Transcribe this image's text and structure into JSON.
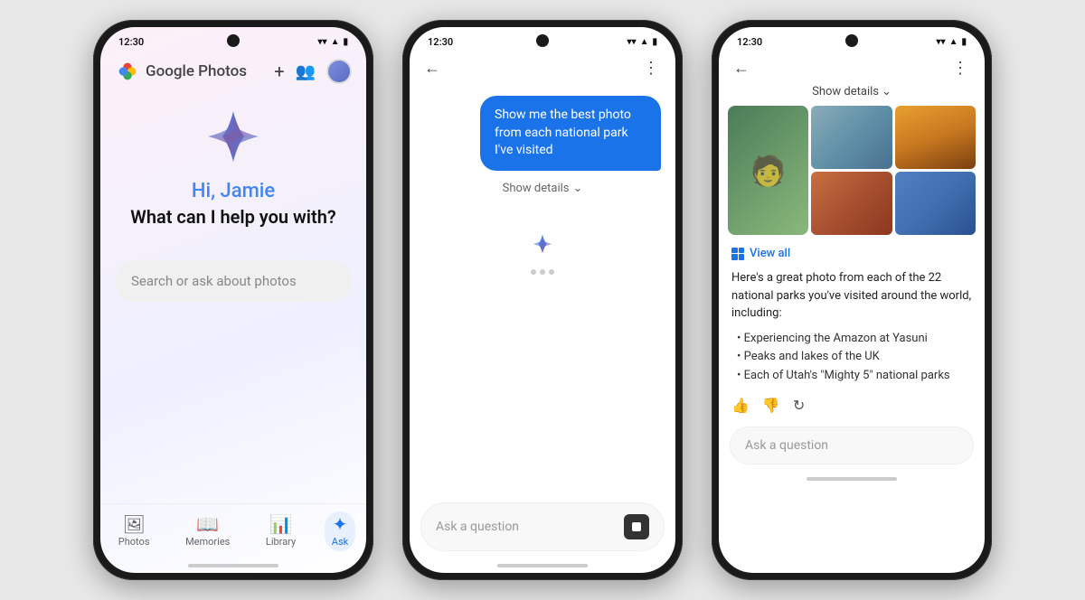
{
  "phone1": {
    "status_time": "12:30",
    "logo_text": "Google Photos",
    "greeting": "Hi, Jamie",
    "subtext": "What can I help you with?",
    "search_placeholder": "Search or ask about photos",
    "nav_items": [
      {
        "label": "Photos",
        "icon": "🖼",
        "active": false
      },
      {
        "label": "Memories",
        "icon": "📖",
        "active": false
      },
      {
        "label": "Library",
        "icon": "📊",
        "active": false
      },
      {
        "label": "Ask",
        "icon": "✦",
        "active": true
      }
    ]
  },
  "phone2": {
    "status_time": "12:30",
    "user_message": "Show me the best photo from each national park I've visited",
    "show_details": "Show details",
    "input_placeholder": "Ask a question"
  },
  "phone3": {
    "status_time": "12:30",
    "show_details": "Show details",
    "view_all": "View all",
    "response_text": "Here's a great photo from each of the 22 national parks you've visited around the world, including:",
    "list_items": [
      "Experiencing the Amazon at Yasuni",
      "Peaks and lakes of the UK",
      "Each of Utah's \"Mighty 5\" national parks"
    ],
    "input_placeholder": "Ask a question"
  },
  "icons": {
    "back_arrow": "←",
    "three_dots": "⋮",
    "plus": "+",
    "people": "👥",
    "chevron_down": "⌄",
    "thumbs_up": "👍",
    "thumbs_down": "👎",
    "refresh": "↻"
  }
}
